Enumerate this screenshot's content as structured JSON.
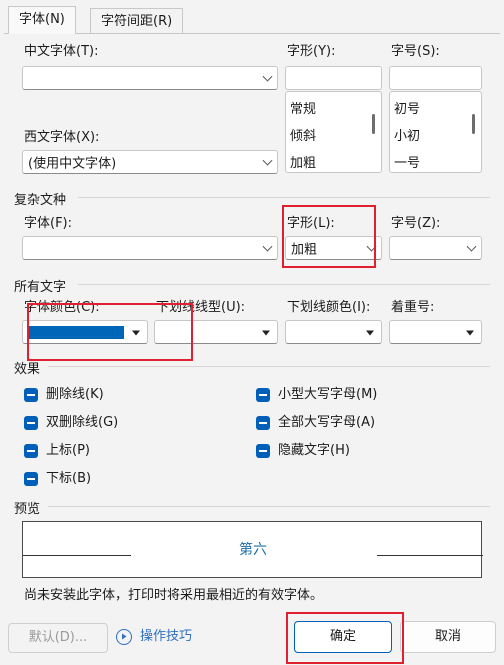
{
  "tabs": [
    "字体(N)",
    "字符间距(R)"
  ],
  "chinese_font": {
    "label": "中文字体(T):",
    "value": ""
  },
  "style": {
    "label": "字形(Y):",
    "value": "",
    "items": [
      "常规",
      "倾斜",
      "加粗"
    ]
  },
  "size": {
    "label": "字号(S):",
    "value": "",
    "items": [
      "初号",
      "小初",
      "一号"
    ]
  },
  "western_font": {
    "label": "西文字体(X):",
    "value": "(使用中文字体)"
  },
  "complex": {
    "heading": "复杂文种",
    "font_label": "字体(F):",
    "font_value": "",
    "style_label": "字形(L):",
    "style_value": "加粗",
    "size_label": "字号(Z):",
    "size_value": ""
  },
  "all_text": {
    "heading": "所有文字",
    "color_label": "字体颜色(C):",
    "color_value": "#0066b8",
    "underline_label": "下划线线型(U):",
    "underline_color_label": "下划线颜色(I):",
    "emphasis_label": "着重号:"
  },
  "effects": {
    "heading": "效果",
    "left": [
      "删除线(K)",
      "双删除线(G)",
      "上标(P)",
      "下标(B)"
    ],
    "right": [
      "小型大写字母(M)",
      "全部大写字母(A)",
      "隐藏文字(H)"
    ]
  },
  "preview": {
    "heading": "预览",
    "text": "第六",
    "text_color": "#1f6fa8"
  },
  "note": "尚未安装此字体，打印时将采用最相近的有效字体。",
  "buttons": {
    "default": "默认(D)...",
    "tips": "操作技巧",
    "ok": "确定",
    "cancel": "取消"
  },
  "colors": {
    "accent": "#005fb8",
    "highlight": "#e0202e"
  }
}
